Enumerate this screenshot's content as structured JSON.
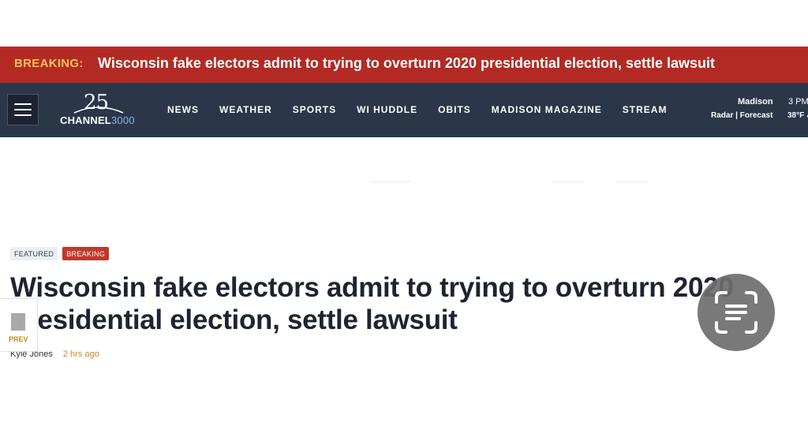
{
  "breaking": {
    "label": "BREAKING:",
    "headline": "Wisconsin fake electors admit to trying to overturn 2020 presidential election, settle lawsuit"
  },
  "nav": {
    "menu_icon": "hamburger-menu-icon",
    "logo": {
      "number": "25",
      "word": "CHANNEL",
      "word_suffix": "3000"
    },
    "links": [
      "NEWS",
      "WEATHER",
      "SPORTS",
      "WI HUDDLE",
      "OBITS",
      "MADISON MAGAZINE",
      "STREAM"
    ],
    "weather": {
      "city": "Madison",
      "radar": "Radar",
      "separator": "|",
      "forecast": "Forecast",
      "time": "3 PM",
      "temp": "38°F",
      "icon": "weather-icon"
    }
  },
  "article": {
    "tags": [
      "FEATURED",
      "BREAKING"
    ],
    "title_line1": "Wisconsin fake electors admit to trying to overturn 2020",
    "title_line2": "presidential election, settle lawsuit",
    "author": "Kyle Jones",
    "time_ago": "2 hrs ago"
  },
  "prev": {
    "label": "PREV"
  },
  "overlay": {
    "icon": "text-scan-icon"
  },
  "colors": {
    "breaking_bg": "#b32a24",
    "breaking_label": "#f4c35a",
    "nav_bg": "#2b3648",
    "tag_breaking": "#c0392b",
    "time_ago": "#c58a2a"
  }
}
